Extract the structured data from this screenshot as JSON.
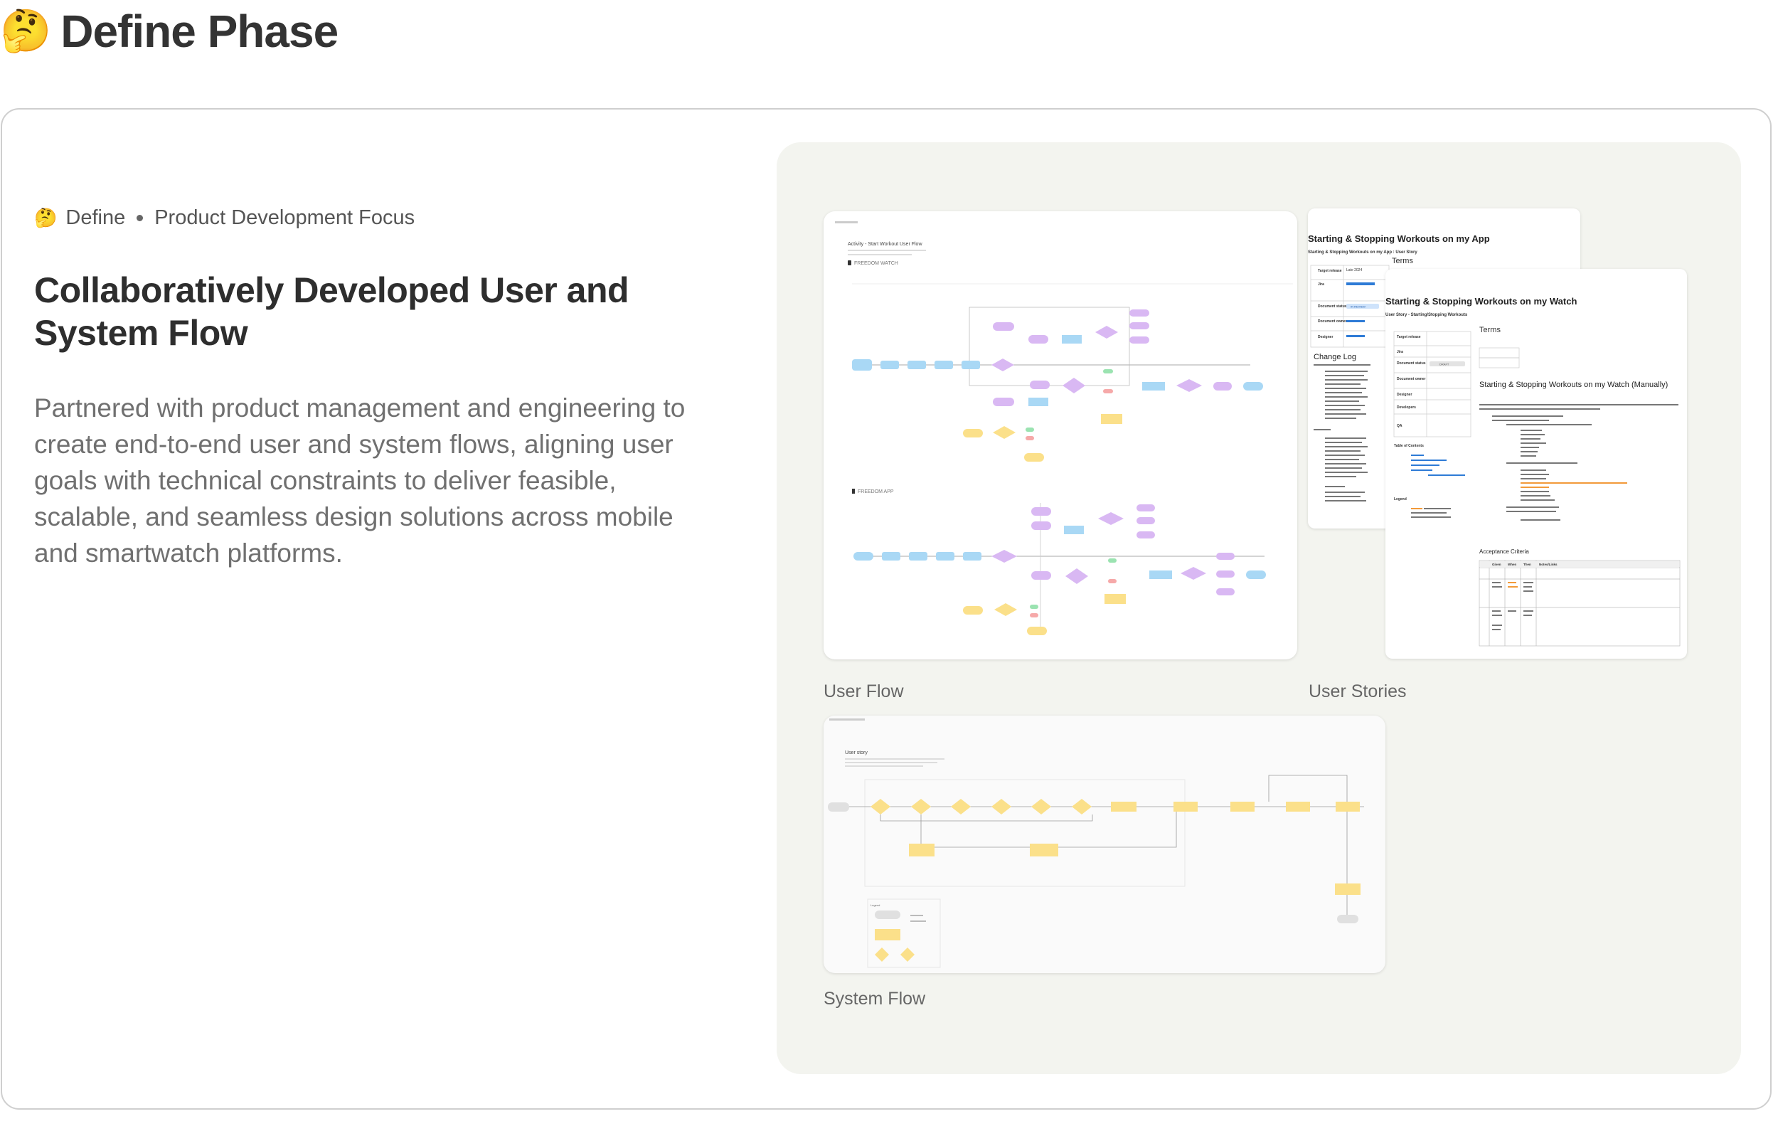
{
  "header": {
    "emoji": "🤔",
    "title": "Define Phase"
  },
  "section": {
    "eyebrow_emoji": "🤔",
    "eyebrow_phase": "Define",
    "eyebrow_focus": "Product Development Focus",
    "headline": "Collaboratively Developed User and System Flow",
    "body": "Partnered with product management and engineering to create end-to-end user and system flows, aligning user goals with technical constraints to deliver feasible, scalable, and seamless design solutions across mobile and smartwatch platforms."
  },
  "gallery": {
    "user_flow": {
      "label": "User Flow",
      "doc_title": "Activity - Start Workout User Flow",
      "lane_watch": "FREEDOM WATCH",
      "lane_app": "FREEDOM APP"
    },
    "user_stories": {
      "label": "User Stories",
      "back_doc": {
        "title": "Starting & Stopping Workouts on my App",
        "subtitle": "Starting & Stopping Workouts on my App : User Story",
        "terms": "Terms",
        "rows": [
          "Target release",
          "Jira",
          "Document status",
          "Document owner",
          "Designer"
        ],
        "target_release": "Late 2024",
        "status_badge": "IN REVIEW",
        "change_log": "Change Log"
      },
      "front_doc": {
        "title": "Starting & Stopping Workouts on my Watch",
        "subtitle": "User Story - Starting/Stopping Workouts",
        "terms": "Terms",
        "rows": [
          "Target release",
          "Jira",
          "Document status",
          "Document owner",
          "Designer",
          "Developers",
          "QA"
        ],
        "status_badge": "DRAFT",
        "section_heading": "Starting & Stopping Workouts on my Watch (Manually)",
        "toc_heading": "Table of Contents",
        "legend_heading": "Legend",
        "acceptance_heading": "Acceptance Criteria",
        "table_headers": [
          "Given",
          "When",
          "Then",
          "Notes/Links"
        ]
      }
    },
    "system_flow": {
      "label": "System Flow",
      "doc_title": "User story",
      "legend_heading": "Legend"
    }
  },
  "colors": {
    "flow_blue": "#a9d8f5",
    "flow_purple": "#d9b8f3",
    "flow_yellow": "#fbe08a",
    "flow_green": "#9be3b1",
    "flow_red": "#f6a9a9",
    "gallery_bg": "#f3f4ef"
  }
}
